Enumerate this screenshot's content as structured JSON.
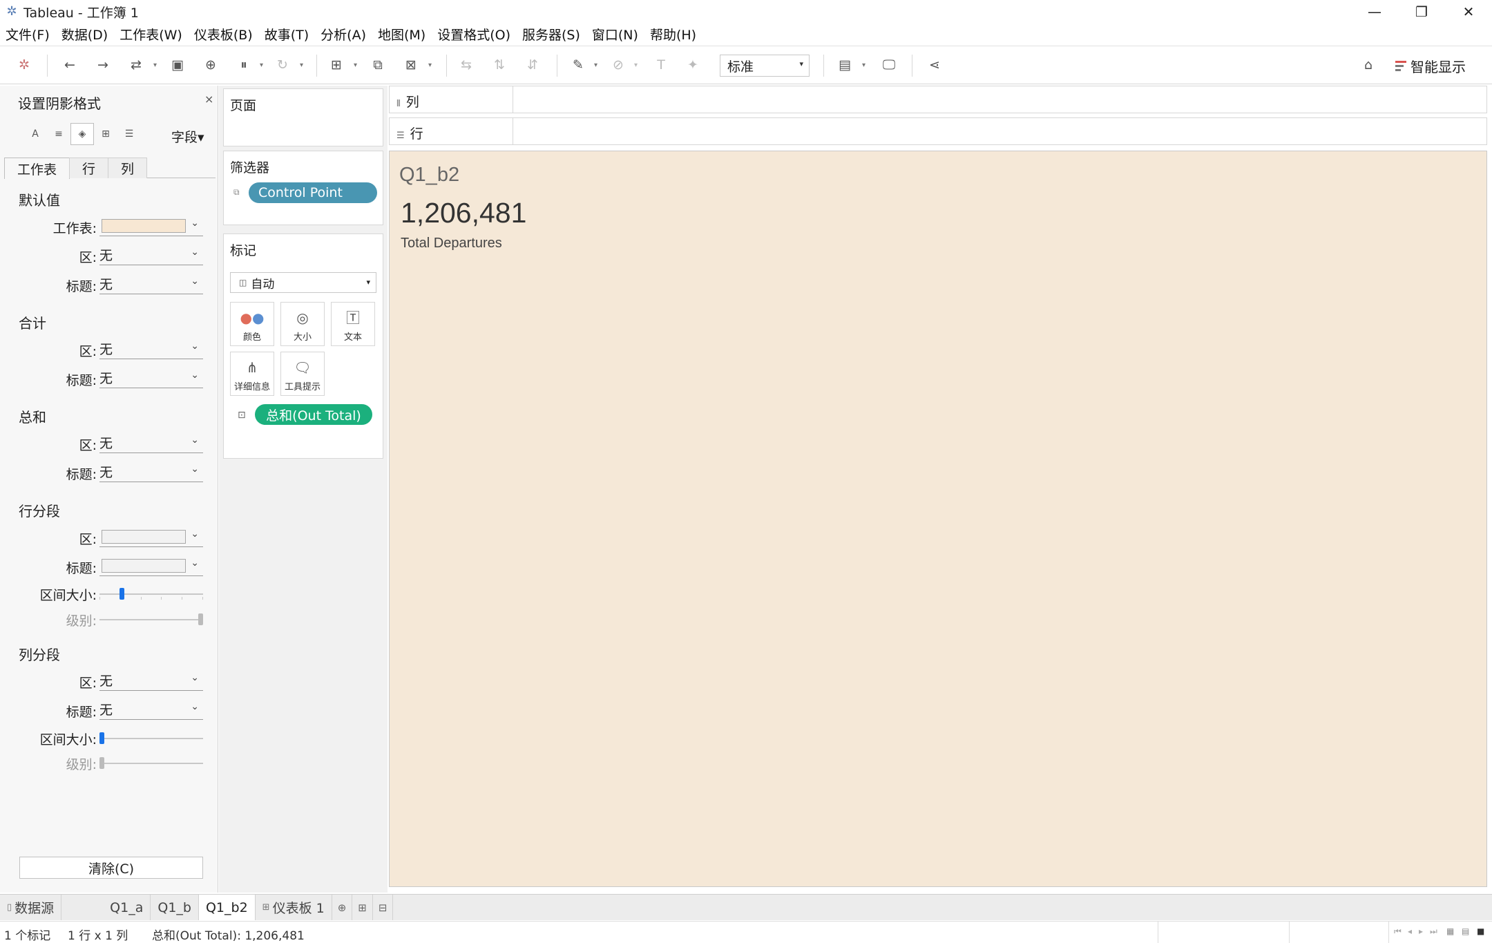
{
  "window": {
    "title": "Tableau - 工作簿 1",
    "minimize": "—",
    "maximize": "❐",
    "close": "✕"
  },
  "menu": [
    "文件(F)",
    "数据(D)",
    "工作表(W)",
    "仪表板(B)",
    "故事(T)",
    "分析(A)",
    "地图(M)",
    "设置格式(O)",
    "服务器(S)",
    "窗口(N)",
    "帮助(H)"
  ],
  "toolbar": {
    "fit_select": "标准",
    "smart_show": "智能显示"
  },
  "format_pane": {
    "title": "设置阴影格式",
    "close": "×",
    "field_dropdown": "字段▾",
    "tabs": [
      "工作表",
      "行",
      "列"
    ],
    "sections": {
      "default": {
        "title": "默认值",
        "worksheet_label": "工作表:",
        "pane_label": "区:",
        "pane_value": "无",
        "header_label": "标题:",
        "header_value": "无",
        "worksheet_color": "#f7e7d3"
      },
      "total": {
        "title": "合计",
        "pane_label": "区:",
        "pane_value": "无",
        "header_label": "标题:",
        "header_value": "无"
      },
      "grand_total": {
        "title": "总和",
        "pane_label": "区:",
        "pane_value": "无",
        "header_label": "标题:",
        "header_value": "无"
      },
      "row_banding": {
        "title": "行分段",
        "pane_label": "区:",
        "header_label": "标题:",
        "band_size_label": "区间大小:",
        "level_label": "级别:",
        "band_size": 0.2,
        "level": 1.0
      },
      "col_banding": {
        "title": "列分段",
        "pane_label": "区:",
        "pane_value": "无",
        "header_label": "标题:",
        "header_value": "无",
        "band_size_label": "区间大小:",
        "level_label": "级别:",
        "band_size": 0.0,
        "level": 0.0
      }
    },
    "clear_button": "清除(C)"
  },
  "cards": {
    "pages": {
      "title": "页面"
    },
    "filters": {
      "title": "筛选器",
      "pill": "Control Point"
    },
    "marks": {
      "title": "标记",
      "type": "自动",
      "buttons": {
        "color": "颜色",
        "size": "大小",
        "text": "文本",
        "detail": "详细信息",
        "tooltip": "工具提示"
      },
      "pill": "总和(Out Total)"
    }
  },
  "shelves": {
    "columns": "列",
    "rows": "行"
  },
  "viz": {
    "title": "Q1_b2",
    "value": "1,206,481",
    "subtitle": "Total Departures",
    "background": "#f5e8d7"
  },
  "sheet_tabs": {
    "datasource": "数据源",
    "tabs": [
      "Q1_a",
      "Q1_b",
      "Q1_b2"
    ],
    "dashboard": "仪表板 1"
  },
  "status": {
    "marks": "1 个标记",
    "dims": "1 行 x 1 列",
    "sum": "总和(Out Total): 1,206,481"
  }
}
